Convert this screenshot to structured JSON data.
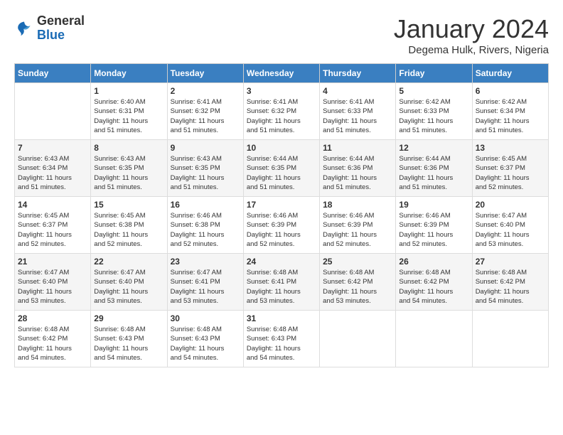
{
  "header": {
    "logo_general": "General",
    "logo_blue": "Blue",
    "month": "January 2024",
    "location": "Degema Hulk, Rivers, Nigeria"
  },
  "days_of_week": [
    "Sunday",
    "Monday",
    "Tuesday",
    "Wednesday",
    "Thursday",
    "Friday",
    "Saturday"
  ],
  "weeks": [
    [
      {
        "day": "",
        "sunrise": "",
        "sunset": "",
        "daylight": ""
      },
      {
        "day": "1",
        "sunrise": "Sunrise: 6:40 AM",
        "sunset": "Sunset: 6:31 PM",
        "daylight": "Daylight: 11 hours and 51 minutes."
      },
      {
        "day": "2",
        "sunrise": "Sunrise: 6:41 AM",
        "sunset": "Sunset: 6:32 PM",
        "daylight": "Daylight: 11 hours and 51 minutes."
      },
      {
        "day": "3",
        "sunrise": "Sunrise: 6:41 AM",
        "sunset": "Sunset: 6:32 PM",
        "daylight": "Daylight: 11 hours and 51 minutes."
      },
      {
        "day": "4",
        "sunrise": "Sunrise: 6:41 AM",
        "sunset": "Sunset: 6:33 PM",
        "daylight": "Daylight: 11 hours and 51 minutes."
      },
      {
        "day": "5",
        "sunrise": "Sunrise: 6:42 AM",
        "sunset": "Sunset: 6:33 PM",
        "daylight": "Daylight: 11 hours and 51 minutes."
      },
      {
        "day": "6",
        "sunrise": "Sunrise: 6:42 AM",
        "sunset": "Sunset: 6:34 PM",
        "daylight": "Daylight: 11 hours and 51 minutes."
      }
    ],
    [
      {
        "day": "7",
        "sunrise": "Sunrise: 6:43 AM",
        "sunset": "Sunset: 6:34 PM",
        "daylight": "Daylight: 11 hours and 51 minutes."
      },
      {
        "day": "8",
        "sunrise": "Sunrise: 6:43 AM",
        "sunset": "Sunset: 6:35 PM",
        "daylight": "Daylight: 11 hours and 51 minutes."
      },
      {
        "day": "9",
        "sunrise": "Sunrise: 6:43 AM",
        "sunset": "Sunset: 6:35 PM",
        "daylight": "Daylight: 11 hours and 51 minutes."
      },
      {
        "day": "10",
        "sunrise": "Sunrise: 6:44 AM",
        "sunset": "Sunset: 6:35 PM",
        "daylight": "Daylight: 11 hours and 51 minutes."
      },
      {
        "day": "11",
        "sunrise": "Sunrise: 6:44 AM",
        "sunset": "Sunset: 6:36 PM",
        "daylight": "Daylight: 11 hours and 51 minutes."
      },
      {
        "day": "12",
        "sunrise": "Sunrise: 6:44 AM",
        "sunset": "Sunset: 6:36 PM",
        "daylight": "Daylight: 11 hours and 51 minutes."
      },
      {
        "day": "13",
        "sunrise": "Sunrise: 6:45 AM",
        "sunset": "Sunset: 6:37 PM",
        "daylight": "Daylight: 11 hours and 52 minutes."
      }
    ],
    [
      {
        "day": "14",
        "sunrise": "Sunrise: 6:45 AM",
        "sunset": "Sunset: 6:37 PM",
        "daylight": "Daylight: 11 hours and 52 minutes."
      },
      {
        "day": "15",
        "sunrise": "Sunrise: 6:45 AM",
        "sunset": "Sunset: 6:38 PM",
        "daylight": "Daylight: 11 hours and 52 minutes."
      },
      {
        "day": "16",
        "sunrise": "Sunrise: 6:46 AM",
        "sunset": "Sunset: 6:38 PM",
        "daylight": "Daylight: 11 hours and 52 minutes."
      },
      {
        "day": "17",
        "sunrise": "Sunrise: 6:46 AM",
        "sunset": "Sunset: 6:39 PM",
        "daylight": "Daylight: 11 hours and 52 minutes."
      },
      {
        "day": "18",
        "sunrise": "Sunrise: 6:46 AM",
        "sunset": "Sunset: 6:39 PM",
        "daylight": "Daylight: 11 hours and 52 minutes."
      },
      {
        "day": "19",
        "sunrise": "Sunrise: 6:46 AM",
        "sunset": "Sunset: 6:39 PM",
        "daylight": "Daylight: 11 hours and 52 minutes."
      },
      {
        "day": "20",
        "sunrise": "Sunrise: 6:47 AM",
        "sunset": "Sunset: 6:40 PM",
        "daylight": "Daylight: 11 hours and 53 minutes."
      }
    ],
    [
      {
        "day": "21",
        "sunrise": "Sunrise: 6:47 AM",
        "sunset": "Sunset: 6:40 PM",
        "daylight": "Daylight: 11 hours and 53 minutes."
      },
      {
        "day": "22",
        "sunrise": "Sunrise: 6:47 AM",
        "sunset": "Sunset: 6:40 PM",
        "daylight": "Daylight: 11 hours and 53 minutes."
      },
      {
        "day": "23",
        "sunrise": "Sunrise: 6:47 AM",
        "sunset": "Sunset: 6:41 PM",
        "daylight": "Daylight: 11 hours and 53 minutes."
      },
      {
        "day": "24",
        "sunrise": "Sunrise: 6:48 AM",
        "sunset": "Sunset: 6:41 PM",
        "daylight": "Daylight: 11 hours and 53 minutes."
      },
      {
        "day": "25",
        "sunrise": "Sunrise: 6:48 AM",
        "sunset": "Sunset: 6:42 PM",
        "daylight": "Daylight: 11 hours and 53 minutes."
      },
      {
        "day": "26",
        "sunrise": "Sunrise: 6:48 AM",
        "sunset": "Sunset: 6:42 PM",
        "daylight": "Daylight: 11 hours and 54 minutes."
      },
      {
        "day": "27",
        "sunrise": "Sunrise: 6:48 AM",
        "sunset": "Sunset: 6:42 PM",
        "daylight": "Daylight: 11 hours and 54 minutes."
      }
    ],
    [
      {
        "day": "28",
        "sunrise": "Sunrise: 6:48 AM",
        "sunset": "Sunset: 6:42 PM",
        "daylight": "Daylight: 11 hours and 54 minutes."
      },
      {
        "day": "29",
        "sunrise": "Sunrise: 6:48 AM",
        "sunset": "Sunset: 6:43 PM",
        "daylight": "Daylight: 11 hours and 54 minutes."
      },
      {
        "day": "30",
        "sunrise": "Sunrise: 6:48 AM",
        "sunset": "Sunset: 6:43 PM",
        "daylight": "Daylight: 11 hours and 54 minutes."
      },
      {
        "day": "31",
        "sunrise": "Sunrise: 6:48 AM",
        "sunset": "Sunset: 6:43 PM",
        "daylight": "Daylight: 11 hours and 54 minutes."
      },
      {
        "day": "",
        "sunrise": "",
        "sunset": "",
        "daylight": ""
      },
      {
        "day": "",
        "sunrise": "",
        "sunset": "",
        "daylight": ""
      },
      {
        "day": "",
        "sunrise": "",
        "sunset": "",
        "daylight": ""
      }
    ]
  ]
}
